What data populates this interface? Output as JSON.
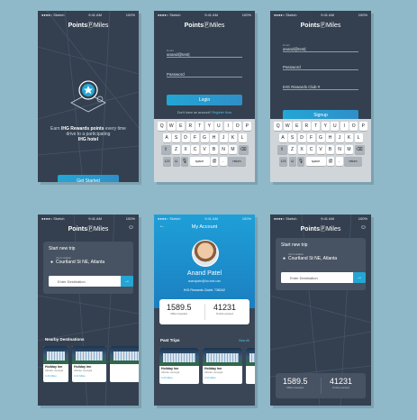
{
  "status_bar": {
    "carrier": "●●●●○ Sketch",
    "time": "9:41 AM",
    "battery": "100%"
  },
  "brand": {
    "prefix": "Points",
    "suffix": "Miles"
  },
  "screen1": {
    "tagline_prefix": "Earn ",
    "tagline_bold": "IHG Rewards points",
    "tagline_rest": " every time drive to a participating",
    "tagline_end": "IHG hotel",
    "cta": "Get Started"
  },
  "screen2": {
    "email_label": "Email",
    "email_value": "anand@test|",
    "password_placeholder": "Password",
    "login": "Login",
    "no_account": "Don't have an account?",
    "register": "Register Now"
  },
  "screen3": {
    "email_label": "Email",
    "email_value": "anand@test|",
    "password_placeholder": "Password",
    "club_placeholder": "IHG Rewards Club #",
    "signup": "Signup",
    "have_account": "Already have an account?",
    "login_link": "Login Here"
  },
  "keyboard": {
    "row1": [
      "Q",
      "W",
      "E",
      "R",
      "T",
      "Y",
      "U",
      "I",
      "O",
      "P"
    ],
    "row2": [
      "A",
      "S",
      "D",
      "F",
      "G",
      "H",
      "J",
      "K",
      "L"
    ],
    "row3": [
      "Z",
      "X",
      "C",
      "V",
      "B",
      "N",
      "M"
    ],
    "shift": "⇧",
    "delete": "⌫",
    "num": "123",
    "emoji": "☺",
    "mic": "🎙",
    "space": "space",
    "at": "@",
    "dot": ".",
    "return": "return"
  },
  "trip": {
    "title": "Start new trip",
    "your_location": "Your Location",
    "location": "Courtland St NE, Atlanta",
    "dest_placeholder": "Enter Destination",
    "go": "→"
  },
  "nearby": {
    "title": "Nearby Destinations",
    "items": [
      {
        "name": "Holiday Inn",
        "addr": "Atlanta, Georgia",
        "miles": "3.24 Miles"
      },
      {
        "name": "Holiday Inn",
        "addr": "Atlanta, Georgia",
        "miles": "3.24 Miles"
      }
    ]
  },
  "account": {
    "title": "My Account",
    "back": "←",
    "name": "Anand Patel",
    "email": "anandpatel@foo.test.com",
    "rewards": "IHG Rewards Club#: 738342",
    "miles_value": "1589.5",
    "miles_label": "Miles traveled",
    "points_value": "41231",
    "points_label": "Points earned",
    "past_trips": "Past Trips",
    "view_all": "View All",
    "trips": [
      {
        "name": "Holiday Inn",
        "addr": "Atlanta, Georgia",
        "miles": "3.24 Miles"
      },
      {
        "name": "Holiday Inn",
        "addr": "Atlanta, Georgia",
        "miles": "3.24 Miles"
      }
    ]
  },
  "screen6": {
    "miles_value": "1589.5",
    "miles_label": "Miles traveled",
    "points_value": "41231",
    "points_label": "Points earned"
  }
}
